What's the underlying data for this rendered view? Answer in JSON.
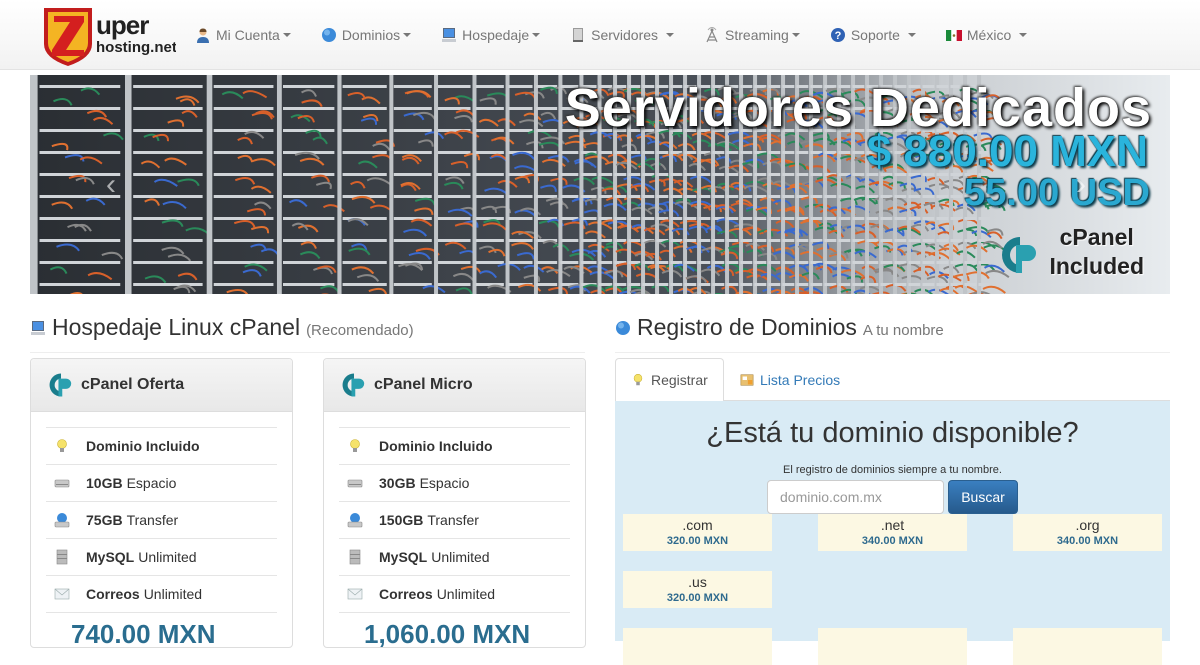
{
  "navbar": {
    "logo_alt": "Zuper hosting.net",
    "items": [
      {
        "label": "Mi Cuenta",
        "icon": "user-icon"
      },
      {
        "label": "Dominios",
        "icon": "globe-icon"
      },
      {
        "label": "Hospedaje",
        "icon": "computer-icon"
      },
      {
        "label": "Servidores",
        "icon": "server-icon"
      },
      {
        "label": "Streaming",
        "icon": "antenna-icon"
      },
      {
        "label": "Soporte",
        "icon": "help-icon"
      },
      {
        "label": "México",
        "icon": "mexico-flag-icon"
      }
    ]
  },
  "banner": {
    "title": "Servidores Dedicados",
    "price_mxn": "$ 880.00 MXN",
    "price_usd": "55.00 USD",
    "cpanel_line1": "cPanel",
    "cpanel_line2": "Included",
    "prev": "‹",
    "next": "›"
  },
  "hosting": {
    "title": "Hospedaje Linux cPanel",
    "subtitle": "(Recomendado)",
    "plans": [
      {
        "name": "cPanel Oferta",
        "features": [
          {
            "bold": "Dominio Incluido",
            "text": ""
          },
          {
            "bold": "10GB",
            "text": "Espacio"
          },
          {
            "bold": "75GB",
            "text": "Transfer"
          },
          {
            "bold": "MySQL",
            "text": "Unlimited"
          },
          {
            "bold": "Correos",
            "text": "Unlimited"
          }
        ],
        "price": "740.00 MXN"
      },
      {
        "name": "cPanel Micro",
        "features": [
          {
            "bold": "Dominio Incluido",
            "text": ""
          },
          {
            "bold": "30GB",
            "text": "Espacio"
          },
          {
            "bold": "150GB",
            "text": "Transfer"
          },
          {
            "bold": "MySQL",
            "text": "Unlimited"
          },
          {
            "bold": "Correos",
            "text": "Unlimited"
          }
        ],
        "price": "1,060.00 MXN"
      }
    ]
  },
  "domains": {
    "title": "Registro de Dominios",
    "subtitle": "A tu nombre",
    "tabs": [
      {
        "label": "Registrar",
        "active": true
      },
      {
        "label": "Lista Precios",
        "active": false
      }
    ],
    "heading": "¿Está tu dominio disponible?",
    "subheading": "El registro de dominios siempre a tu nombre.",
    "input_placeholder": "dominio.com.mx",
    "search_button": "Buscar",
    "tlds": [
      {
        "name": ".com",
        "price": "320.00 MXN"
      },
      {
        "name": ".net",
        "price": "340.00 MXN"
      },
      {
        "name": ".org",
        "price": "340.00 MXN"
      },
      {
        "name": ".us",
        "price": "320.00 MXN"
      }
    ]
  },
  "colors": {
    "accent": "#337ab7",
    "price": "#2a6d8f",
    "domain_panel": "#d9ebf5",
    "tld_box": "#fcf8e3",
    "banner_price": "#2ab4dc"
  }
}
